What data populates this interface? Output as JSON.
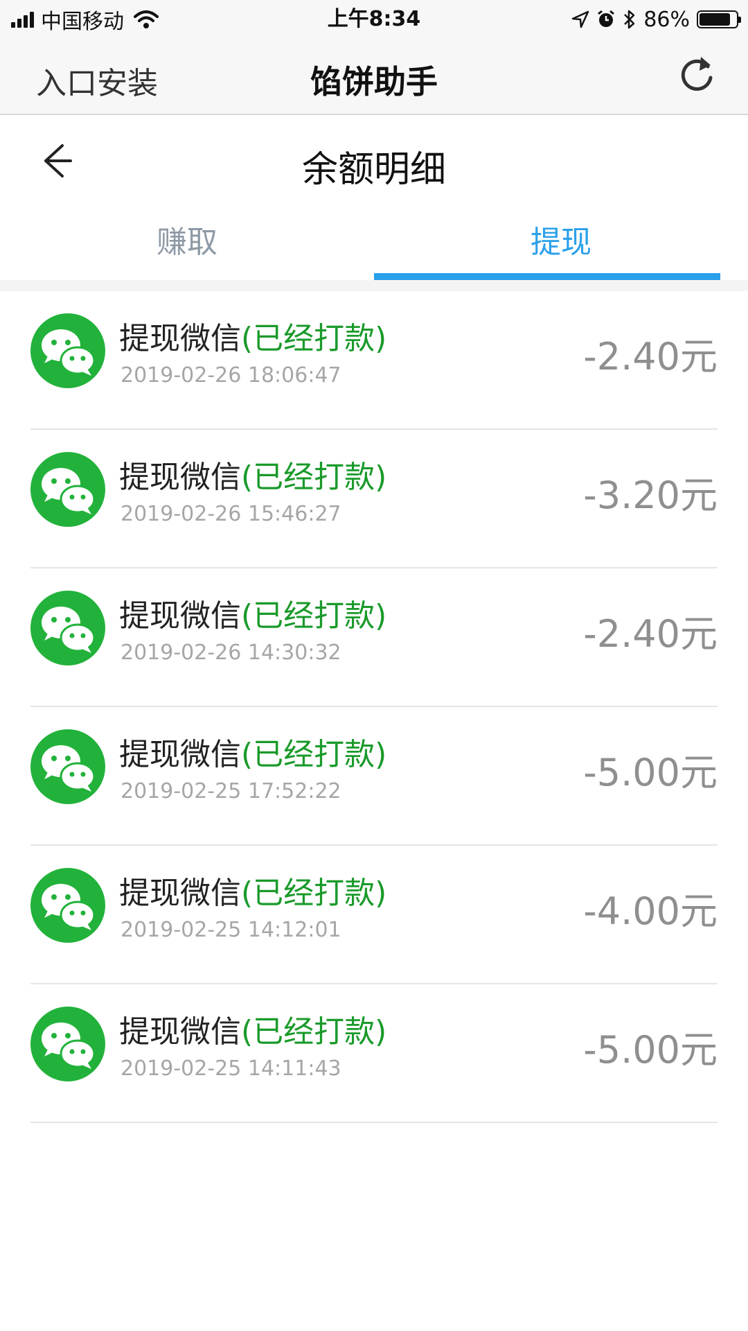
{
  "status_bar": {
    "carrier": "中国移动",
    "time": "上午8:34",
    "battery_percent": "86%",
    "battery_level": 0.86
  },
  "nav": {
    "left_label": "入口安装",
    "title": "馅饼助手",
    "refresh_icon": "refresh-icon"
  },
  "page": {
    "back_icon": "back-arrow-icon",
    "title": "余额明细"
  },
  "tabs": [
    {
      "label": "赚取",
      "active": false
    },
    {
      "label": "提现",
      "active": true
    }
  ],
  "colors": {
    "accent": "#2aa0ea",
    "success_green": "#1a9a2a",
    "wechat_green": "#22b23b"
  },
  "records": [
    {
      "title": "提现微信",
      "status": "(已经打款)",
      "time": "2019-02-26 18:06:47",
      "amount": "-2.40元"
    },
    {
      "title": "提现微信",
      "status": "(已经打款)",
      "time": "2019-02-26 15:46:27",
      "amount": "-3.20元"
    },
    {
      "title": "提现微信",
      "status": "(已经打款)",
      "time": "2019-02-26 14:30:32",
      "amount": "-2.40元"
    },
    {
      "title": "提现微信",
      "status": "(已经打款)",
      "time": "2019-02-25 17:52:22",
      "amount": "-5.00元"
    },
    {
      "title": "提现微信",
      "status": "(已经打款)",
      "time": "2019-02-25 14:12:01",
      "amount": "-4.00元"
    },
    {
      "title": "提现微信",
      "status": "(已经打款)",
      "time": "2019-02-25 14:11:43",
      "amount": "-5.00元"
    }
  ]
}
